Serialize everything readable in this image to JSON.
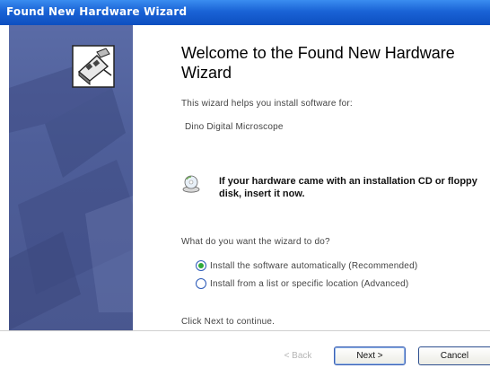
{
  "window": {
    "title": "Found New Hardware Wizard"
  },
  "main": {
    "heading": "Welcome to the Found New Hardware Wizard",
    "intro": "This wizard helps you install software for:",
    "device_name": "Dino Digital Microscope",
    "cd_notice": "If your hardware came with an installation CD or floppy disk, insert it now.",
    "question": "What do you want the wizard to do?",
    "options": [
      {
        "label": "Install the software automatically (Recommended)",
        "selected": true
      },
      {
        "label": "Install from a list or specific location (Advanced)",
        "selected": false
      }
    ],
    "continue_hint": "Click Next to continue."
  },
  "buttons": {
    "back": "< Back",
    "next": "Next >",
    "cancel": "Cancel"
  },
  "icons": {
    "banner_icon": "hardware-card-icon",
    "cd_icon": "cd-drive-icon"
  },
  "colors": {
    "titlebar": "#1a63d6",
    "banner": "#4e5e99",
    "radio_selected": "#2eaa3a"
  }
}
